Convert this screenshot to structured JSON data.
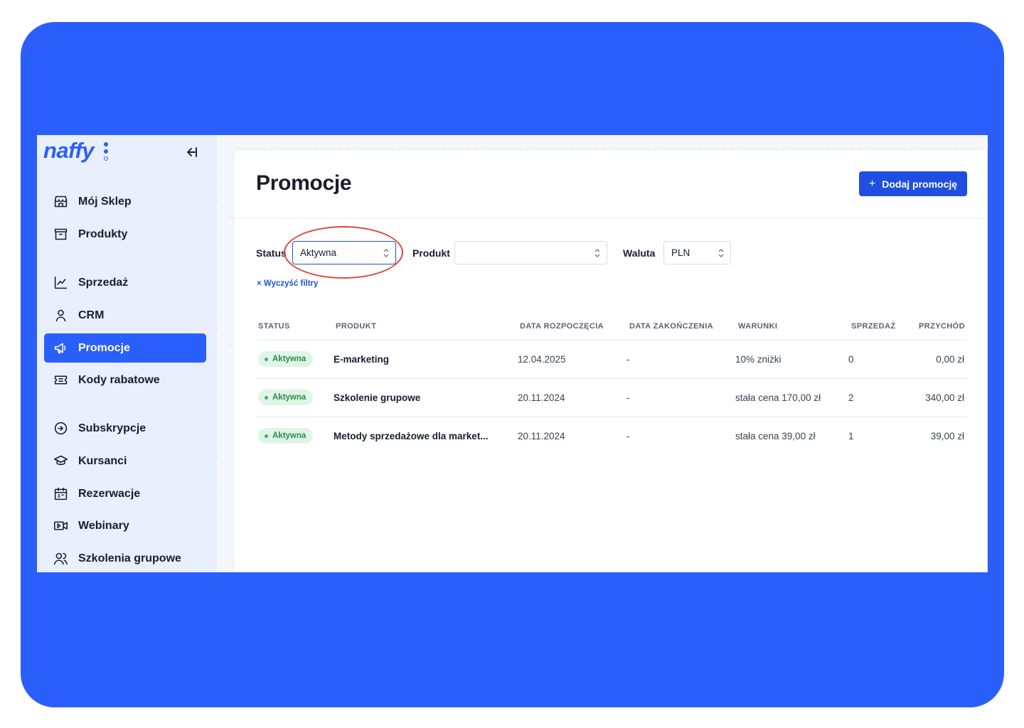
{
  "brand": {
    "logo_text": "naffy",
    "color": "#2a5ffb"
  },
  "sidebar": {
    "collapse_icon": "collapse-left-icon",
    "items": [
      {
        "label": "Mój Sklep",
        "icon": "store-icon",
        "active": false
      },
      {
        "label": "Produkty",
        "icon": "box-icon",
        "active": false
      },
      {
        "label": "Sprzedaż",
        "icon": "chart-line-icon",
        "active": false
      },
      {
        "label": "CRM",
        "icon": "user-icon",
        "active": false
      },
      {
        "label": "Promocje",
        "icon": "megaphone-icon",
        "active": true
      },
      {
        "label": "Kody rabatowe",
        "icon": "ticket-icon",
        "active": false
      },
      {
        "label": "Subskrypcje",
        "icon": "subscription-icon",
        "active": false
      },
      {
        "label": "Kursanci",
        "icon": "graduation-cap-icon",
        "active": false
      },
      {
        "label": "Rezerwacje",
        "icon": "calendar-icon",
        "active": false
      },
      {
        "label": "Webinary",
        "icon": "video-icon",
        "active": false
      },
      {
        "label": "Szkolenia grupowe",
        "icon": "group-icon",
        "active": false
      }
    ]
  },
  "main": {
    "title": "Promocje",
    "add_button": {
      "icon": "+",
      "label": "Dodaj promocję"
    },
    "filters": {
      "status": {
        "label": "Status",
        "value": "Aktywna"
      },
      "product": {
        "label": "Produkt",
        "value": ""
      },
      "currency": {
        "label": "Waluta",
        "value": "PLN"
      },
      "clear": {
        "icon": "×",
        "label": "Wyczyść filtry"
      }
    },
    "table": {
      "headers": [
        "Status",
        "Produkt",
        "Data rozpoczęcia",
        "Data zakończenia",
        "Warunki",
        "Sprzedaż",
        "Przychód"
      ],
      "rows": [
        {
          "status": "Aktywna",
          "product": "E-marketing",
          "start": "12.04.2025",
          "end": "-",
          "conditions": "10% zniżki",
          "sales": "0",
          "revenue": "0,00 zł"
        },
        {
          "status": "Aktywna",
          "product": "Szkolenie grupowe",
          "start": "20.11.2024",
          "end": "-",
          "conditions": "stała cena 170,00 zł",
          "sales": "2",
          "revenue": "340,00 zł"
        },
        {
          "status": "Aktywna",
          "product": "Metody sprzedażowe dla market...",
          "start": "20.11.2024",
          "end": "-",
          "conditions": "stała cena 39,00 zł",
          "sales": "1",
          "revenue": "39,00 zł"
        }
      ]
    }
  },
  "colors": {
    "accent": "#2a5ffb",
    "button": "#1f4fe0",
    "badge_bg": "#dff5e6",
    "badge_text": "#2c8a4e",
    "highlight": "#e0443a"
  }
}
